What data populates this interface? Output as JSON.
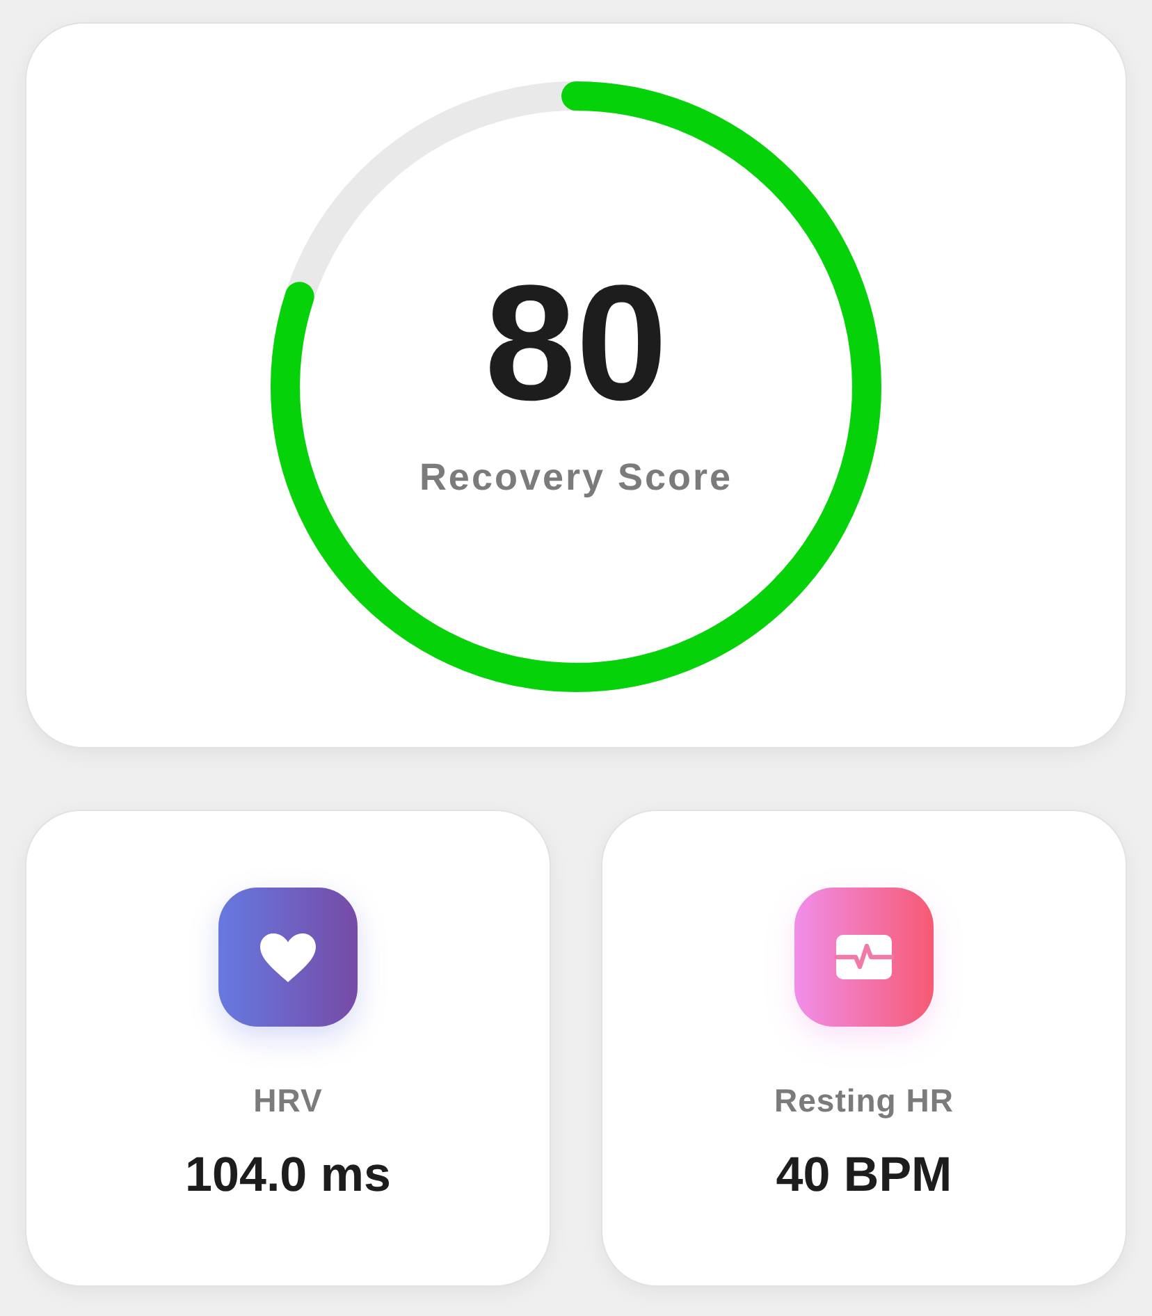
{
  "recovery": {
    "score": "80",
    "label": "Recovery Score",
    "level": 0.8
  },
  "metrics": [
    {
      "kind": "heart",
      "label": "HRV",
      "value": "104.0 ms"
    },
    {
      "kind": "pulse",
      "label": "Resting HR",
      "value": "40 BPM"
    }
  ]
}
